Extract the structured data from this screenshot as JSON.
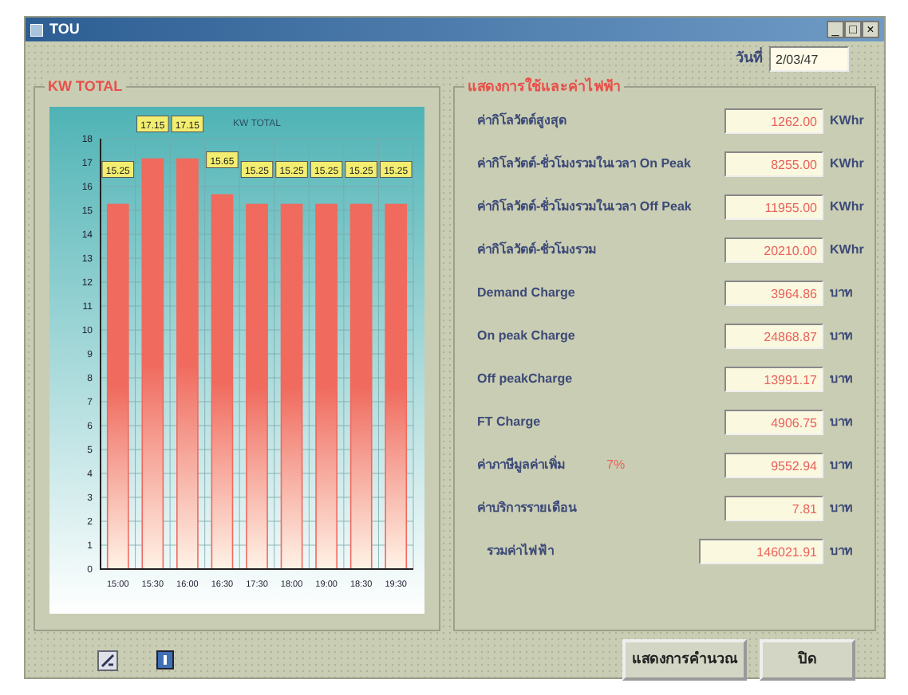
{
  "window": {
    "title": "TOU",
    "controls": [
      "_",
      "□",
      "×"
    ]
  },
  "date": {
    "label": "วันที่",
    "value": "2/03/47"
  },
  "chart_group": {
    "title": "KW TOTAL",
    "chart_data": {
      "type": "bar",
      "title": "KW TOTAL",
      "categories": [
        "15:00",
        "15:30",
        "16:00",
        "16:30",
        "17:30",
        "18:00",
        "19:00",
        "18:30",
        "19:30"
      ],
      "grid": true,
      "series": [
        {
          "color": "#f06a5e",
          "values": [
            15.25,
            17.15,
            17.15,
            15.65,
            15.25,
            15.25,
            15.25,
            15.25,
            15.25
          ]
        }
      ],
      "ylim": [
        0,
        18
      ],
      "yticks": [
        0,
        1,
        2,
        3,
        4,
        5,
        6,
        7,
        8,
        9,
        10,
        11,
        12,
        13,
        14,
        15,
        16,
        17,
        18
      ],
      "value_labels": [
        "15.25",
        "17.15",
        "17.15",
        "15.65",
        "15.25",
        "15.25",
        "15.25",
        "15.25",
        "15.25"
      ]
    }
  },
  "summary_group": {
    "title": "แสดงการใช้และค่าไฟฟ้า",
    "rows": [
      {
        "label": "ค่ากิโลวัตต์สูงสุด",
        "value": "1262.00",
        "unit": "KWhr"
      },
      {
        "label": "ค่ากิโลวัตต์-ชั่วโมงรวมในเวลา On Peak",
        "value": "8255.00",
        "unit": "KWhr"
      },
      {
        "label": "ค่ากิโลวัตต์-ชั่วโมงรวมในเวลา Off Peak",
        "value": "11955.00",
        "unit": "KWhr"
      },
      {
        "label": "ค่ากิโลวัตต์-ชั่วโมงรวม",
        "value": "20210.00",
        "unit": "KWhr"
      },
      {
        "label": "Demand Charge",
        "value": "3964.86",
        "unit": "บาท"
      },
      {
        "label": "On peak Charge",
        "value": "24868.87",
        "unit": "บาท"
      },
      {
        "label": "Off peakCharge",
        "value": "13991.17",
        "unit": "บาท"
      },
      {
        "label": "FT Charge",
        "value": "4906.75",
        "unit": "บาท"
      },
      {
        "label": "ค่าภาษีมูลค่าเพิ่ม",
        "note": "7%",
        "value": "9552.94",
        "unit": "บาท"
      },
      {
        "label": "ค่าบริการรายเดือน",
        "value": "7.81",
        "unit": "บาท"
      },
      {
        "label": "รวมค่าไฟฟ้า",
        "value": "146021.91",
        "unit": "บาท",
        "total": true
      }
    ]
  },
  "buttons": [
    "แสดงการคำนวณ",
    "ปิด"
  ]
}
